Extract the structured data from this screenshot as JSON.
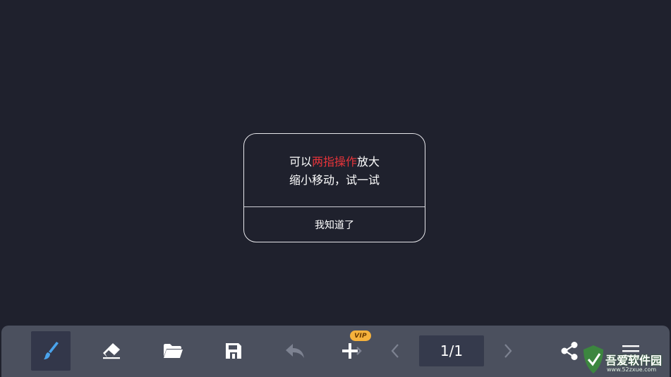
{
  "dialog": {
    "line1_prefix": "可以",
    "line1_highlight": "两指操作",
    "line1_suffix": "放大",
    "line2": "缩小移动，试一试",
    "confirm_label": "我知道了",
    "highlight_color": "#e8343a"
  },
  "toolbar": {
    "tools": [
      {
        "name": "brush",
        "icon": "brush-icon",
        "active": true
      },
      {
        "name": "eraser",
        "icon": "eraser-icon"
      },
      {
        "name": "open",
        "icon": "folder-open-icon"
      },
      {
        "name": "save",
        "icon": "save-icon"
      },
      {
        "name": "undo",
        "icon": "undo-icon",
        "disabled": true
      },
      {
        "name": "add-page",
        "icon": "plus-icon"
      },
      {
        "name": "prev-page",
        "icon": "chevron-left-icon",
        "disabled": true
      },
      {
        "name": "next-page",
        "icon": "chevron-right-icon",
        "disabled": true
      },
      {
        "name": "share",
        "icon": "share-icon"
      },
      {
        "name": "menu",
        "icon": "menu-icon"
      }
    ],
    "vip_badge": "VIP",
    "page_indicator": "1/1"
  },
  "watermark": {
    "text": "吾爱软件园",
    "url": "www.52zxue.com"
  },
  "colors": {
    "background": "#1f212d",
    "toolbar": "#4b505e",
    "brush_accent": "#4aa3ec",
    "vip": "#f6b23c"
  }
}
